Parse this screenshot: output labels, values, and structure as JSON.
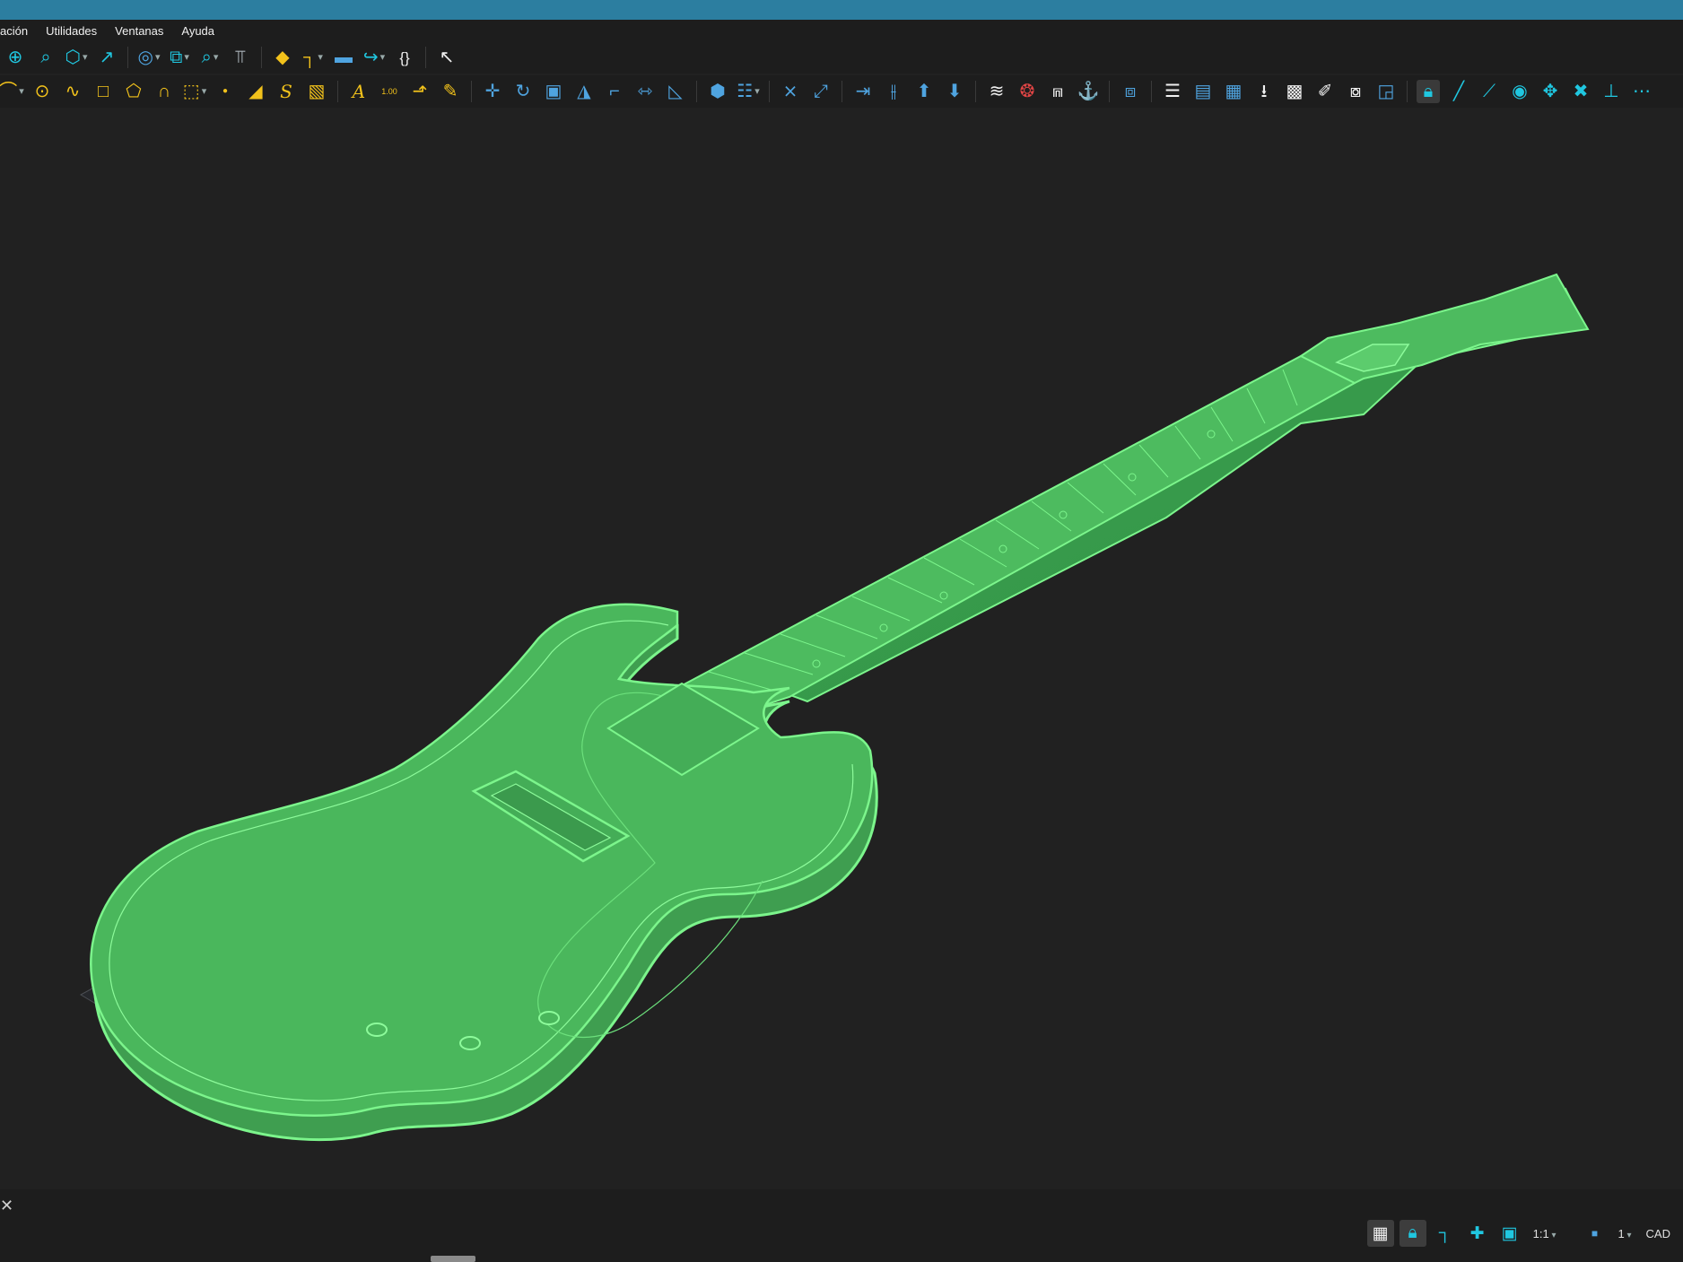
{
  "menu": [
    "ación",
    "Utilidades",
    "Ventanas",
    "Ayuda"
  ],
  "toolbar1": {
    "icons": [
      "zoom-extents-icon",
      "zoom-window-icon",
      "view-cube-icon",
      "zoom-previous-icon",
      "visual-style-icon",
      "view-orbit-icon",
      "zoom-realtime-icon",
      "measure-icon",
      "layer-manager-icon",
      "ucs-icon",
      "open-folder-icon",
      "export-icon",
      "code-braces-icon",
      "select-cursor-icon"
    ],
    "braces_label": "{}"
  },
  "toolbar2": {
    "icons": [
      "arc-icon",
      "circle-icon",
      "polyline-icon",
      "rectangle-icon",
      "polygon-icon",
      "spline-icon",
      "hatch-boundary-icon",
      "point-icon",
      "eraser-icon",
      "text-style-icon",
      "hatch-icon",
      "text-icon",
      "dimension-icon",
      "leader-icon",
      "edit-text-icon",
      "move-icon",
      "rotate-icon",
      "scale-icon",
      "mirror-icon",
      "offset-icon",
      "stretch-icon",
      "align-icon",
      "block-icon",
      "array-icon",
      "trim-icon",
      "extend-icon",
      "join-icon",
      "break-icon",
      "bring-up-icon",
      "send-down-icon",
      "wave-icon",
      "3d-rotate-icon",
      "flatten-icon",
      "anchor-icon",
      "solid-icon",
      "xref-icon",
      "insert-folder-icon",
      "insert-image-icon",
      "download-icon",
      "image-icon",
      "paint-icon",
      "overlap-icon",
      "edit-block-icon",
      "lock-icon",
      "snap-line-icon",
      "snap-end-icon",
      "snap-center-icon",
      "snap-node-icon",
      "snap-intersection-icon",
      "snap-perp-icon",
      "more-icon"
    ],
    "dimension_label": "1.00",
    "text_label": "A",
    "spline_label": "S"
  },
  "statusbar": {
    "scale": "1:1",
    "layout": "1",
    "mode": "CAD"
  },
  "colors": {
    "title_bar": "#2c7ea0",
    "background": "#212121",
    "model_fill": "#47b35a",
    "model_edge": "#7cf58c"
  }
}
